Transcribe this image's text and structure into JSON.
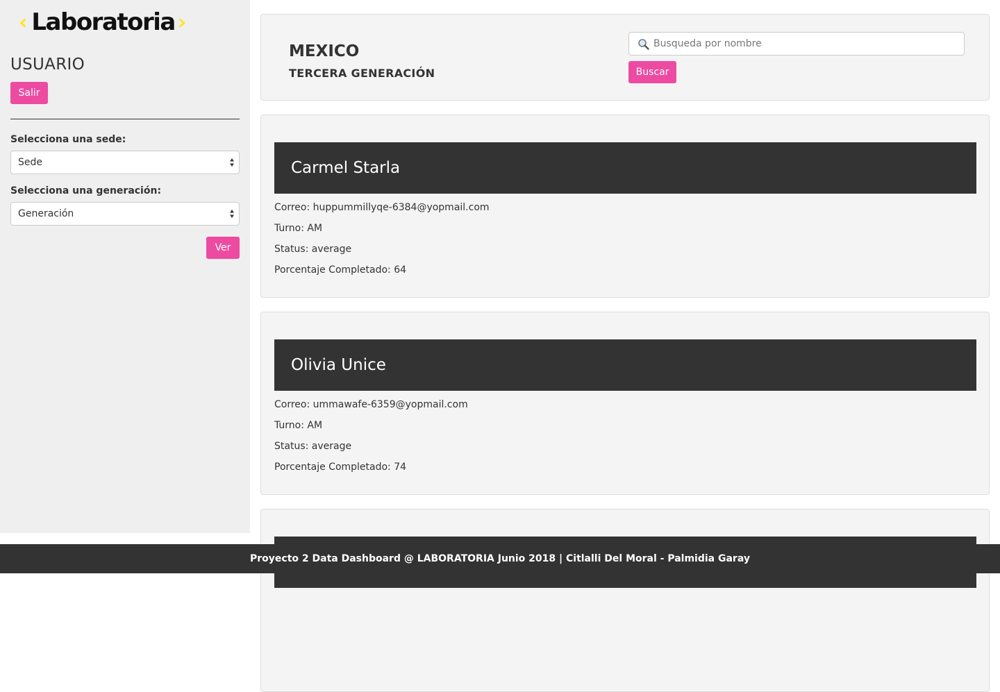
{
  "brand": {
    "name": "Laboratoria",
    "accent": "#ffe521"
  },
  "sidebar": {
    "user_title": "USUARIO",
    "logout_label": "Salir",
    "sede_label": "Selecciona una sede:",
    "sede_selected": "Sede",
    "generation_label": "Selecciona una generación:",
    "generation_selected": "Generación",
    "view_label": "Ver"
  },
  "header": {
    "sede": "MEXICO",
    "generation": "TERCERA GENERACIÓN",
    "search_placeholder": "Busqueda por nombre",
    "search_value": "",
    "search_button": "Buscar"
  },
  "students": [
    {
      "name": "Carmel Starla",
      "email": "Correo: huppummillyqe-6384@yopmail.com",
      "turn": "Turno: AM",
      "status": "Status: average",
      "percent": "Porcentaje Completado: 64"
    },
    {
      "name": "Olivia Unice",
      "email": "Correo: ummawafe-6359@yopmail.com",
      "turn": "Turno: AM",
      "status": "Status: average",
      "percent": "Porcentaje Completado: 74"
    }
  ],
  "footer": {
    "text": "Proyecto 2 Data Dashboard @ LABORATORIA Junio 2018 | Citlalli Del Moral - Palmidia Garay"
  },
  "colors": {
    "pink": "#ec4ba1",
    "dark": "#333333",
    "panel": "#f4f4f4",
    "sidebar": "#efefef"
  }
}
